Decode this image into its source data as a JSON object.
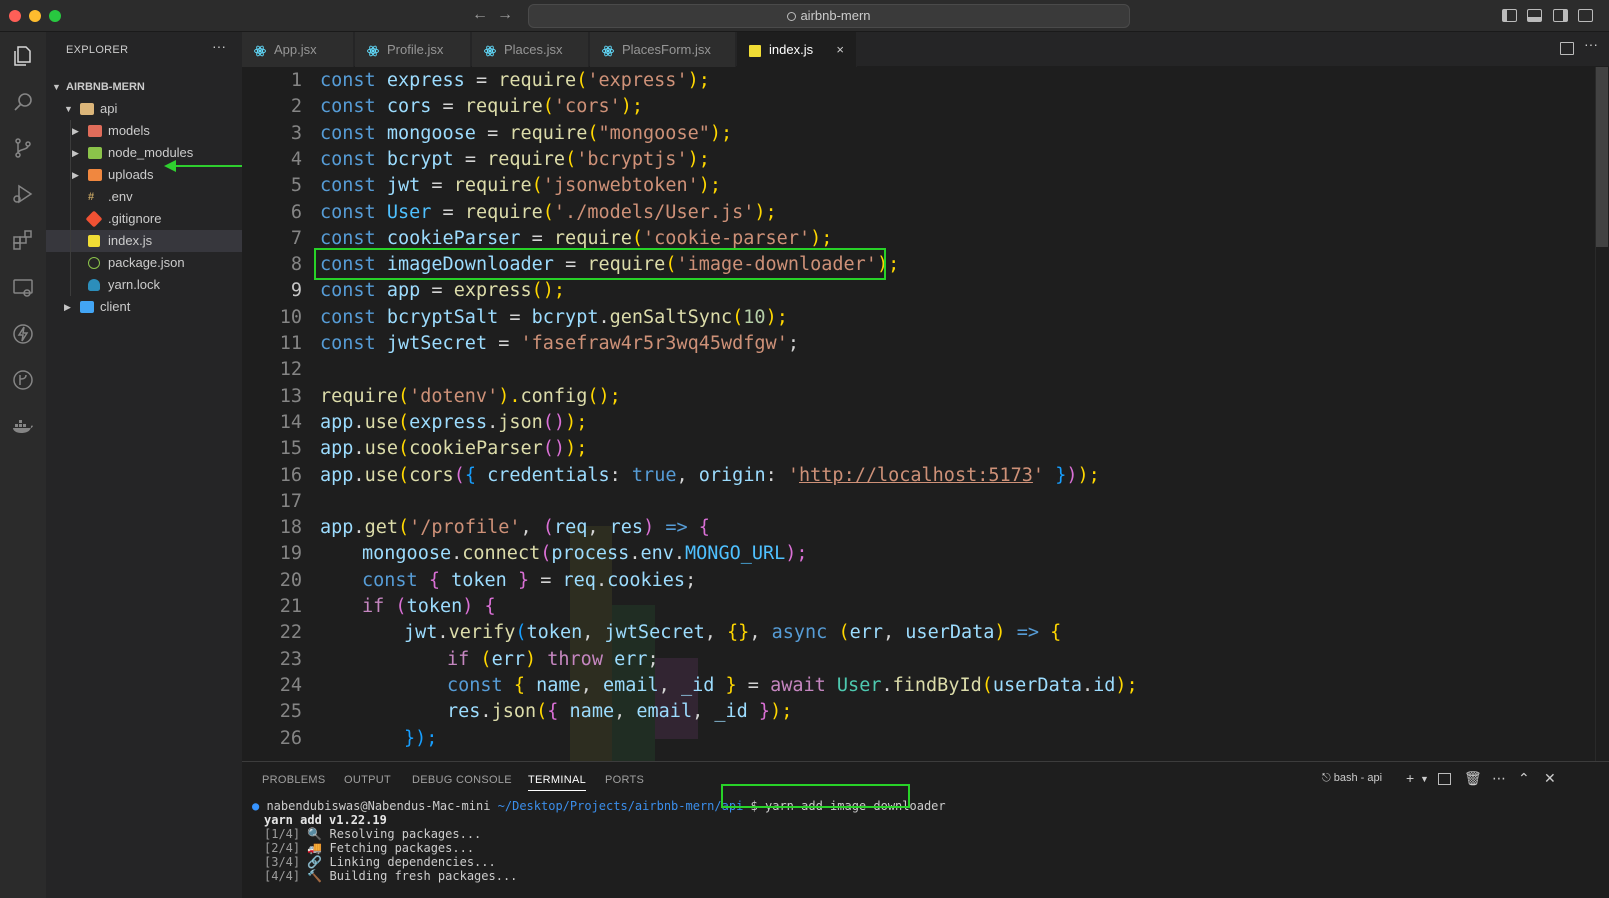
{
  "window": {
    "search_title": "airbnb-mern"
  },
  "explorer": {
    "header": "EXPLORER",
    "more": "···",
    "root": "AIRBNB-MERN",
    "items": [
      {
        "label": "api"
      },
      {
        "label": "models"
      },
      {
        "label": "node_modules"
      },
      {
        "label": "uploads"
      },
      {
        "label": ".env"
      },
      {
        "label": ".gitignore"
      },
      {
        "label": "index.js"
      },
      {
        "label": "package.json"
      },
      {
        "label": "yarn.lock"
      },
      {
        "label": "client"
      }
    ]
  },
  "tabs": [
    {
      "label": "App.jsx"
    },
    {
      "label": "Profile.jsx"
    },
    {
      "label": "Places.jsx"
    },
    {
      "label": "PlacesForm.jsx"
    },
    {
      "label": "index.js",
      "close": "×"
    }
  ],
  "editor": {
    "line_numbers": [
      "1",
      "2",
      "3",
      "4",
      "5",
      "6",
      "7",
      "8",
      "9",
      "10",
      "11",
      "12",
      "13",
      "14",
      "15",
      "16",
      "17",
      "18",
      "19",
      "20",
      "21",
      "22",
      "23",
      "24",
      "25",
      "26"
    ],
    "code": {
      "l1": [
        "const",
        " express ",
        "= ",
        "require",
        "(",
        "'express'",
        ");"
      ],
      "l2": [
        "const",
        " cors ",
        "= ",
        "require",
        "(",
        "'cors'",
        ");"
      ],
      "l3": [
        "const",
        " mongoose ",
        "= ",
        "require",
        "(",
        "\"mongoose\"",
        ");"
      ],
      "l4": [
        "const",
        " bcrypt ",
        "= ",
        "require",
        "(",
        "'bcryptjs'",
        ");"
      ],
      "l5": [
        "const",
        " jwt ",
        "= ",
        "require",
        "(",
        "'jsonwebtoken'",
        ");"
      ],
      "l6": [
        "const",
        " User ",
        "= ",
        "require",
        "(",
        "'./models/User.js'",
        ");"
      ],
      "l7": [
        "const",
        " cookieParser ",
        "= ",
        "require",
        "(",
        "'cookie-parser'",
        ");"
      ],
      "l8": [
        "const",
        " imageDownloader ",
        "= ",
        "require",
        "(",
        "'image-downloader'",
        ");"
      ],
      "l9": [
        "const",
        " app ",
        "= ",
        "express",
        "();"
      ],
      "l10": [
        "const",
        " bcryptSalt ",
        "= ",
        "bcrypt",
        ".",
        "genSaltSync",
        "(",
        "10",
        ");"
      ],
      "l11": [
        "const",
        " jwtSecret ",
        "= ",
        "'fasefraw4r5r3wq45wdfgw'",
        ";"
      ],
      "l13": [
        "require",
        "(",
        "'dotenv'",
        ").",
        "config",
        "();"
      ],
      "l14": [
        "app",
        ".",
        "use",
        "(",
        "express",
        ".",
        "json",
        "()",
        ");"
      ],
      "l15": [
        "app",
        ".",
        "use",
        "(",
        "cookieParser",
        "()",
        ");"
      ],
      "l16": [
        "app",
        ".",
        "use",
        "(",
        "cors",
        "(",
        "{ ",
        "credentials",
        ": ",
        "true",
        ", ",
        "origin",
        ": ",
        "'",
        "http://localhost:5173",
        "'",
        " }",
        ")",
        ");"
      ],
      "l18": [
        "app",
        ".",
        "get",
        "(",
        "'/profile'",
        ", ",
        "(",
        "req",
        ", ",
        "res",
        ") ",
        "=>",
        " {"
      ],
      "l19": [
        "mongoose",
        ".",
        "connect",
        "(",
        "process",
        ".",
        "env",
        ".",
        "MONGO_URL",
        ");"
      ],
      "l20": [
        "const",
        " { ",
        "token",
        " } ",
        "= ",
        "req",
        ".",
        "cookies",
        ";"
      ],
      "l21": [
        "if",
        " (",
        "token",
        ") ",
        "{"
      ],
      "l22": [
        "jwt",
        ".",
        "verify",
        "(",
        "token",
        ", ",
        "jwtSecret",
        ", ",
        "{}",
        ", ",
        "async",
        " (",
        "err",
        ", ",
        "userData",
        ") ",
        "=>",
        " {"
      ],
      "l23": [
        "if",
        " (",
        "err",
        ") ",
        "throw",
        " err",
        ";"
      ],
      "l24": [
        "const",
        " { ",
        "name",
        ", ",
        "email",
        ", ",
        "_id",
        " } ",
        "= ",
        "await",
        " User",
        ".",
        "findById",
        "(",
        "userData",
        ".",
        "id",
        ");"
      ],
      "l25": [
        "res",
        ".",
        "json",
        "(",
        "{ ",
        "name",
        ", ",
        "email",
        ", ",
        "_id",
        " }",
        ");"
      ],
      "l26": [
        "});"
      ]
    }
  },
  "panel": {
    "tabs": [
      "PROBLEMS",
      "OUTPUT",
      "DEBUG CONSOLE",
      "TERMINAL",
      "PORTS"
    ],
    "shell": "bash - api",
    "terminal": {
      "user": "nabendubiswas@Nabendus-Mac-mini",
      "path": "~/Desktop/Projects/airbnb-mern/api",
      "prompt": "$",
      "command": "yarn add image-downloader",
      "version": "yarn add v1.22.19",
      "steps": [
        {
          "idx": "[1/4]",
          "text": "Resolving packages..."
        },
        {
          "idx": "[2/4]",
          "text": "Fetching packages..."
        },
        {
          "idx": "[3/4]",
          "text": "Linking dependencies..."
        },
        {
          "idx": "[4/4]",
          "text": "Building fresh packages..."
        }
      ]
    }
  },
  "colors": {
    "highlight": "#28d228",
    "accent": "#3794ff"
  }
}
